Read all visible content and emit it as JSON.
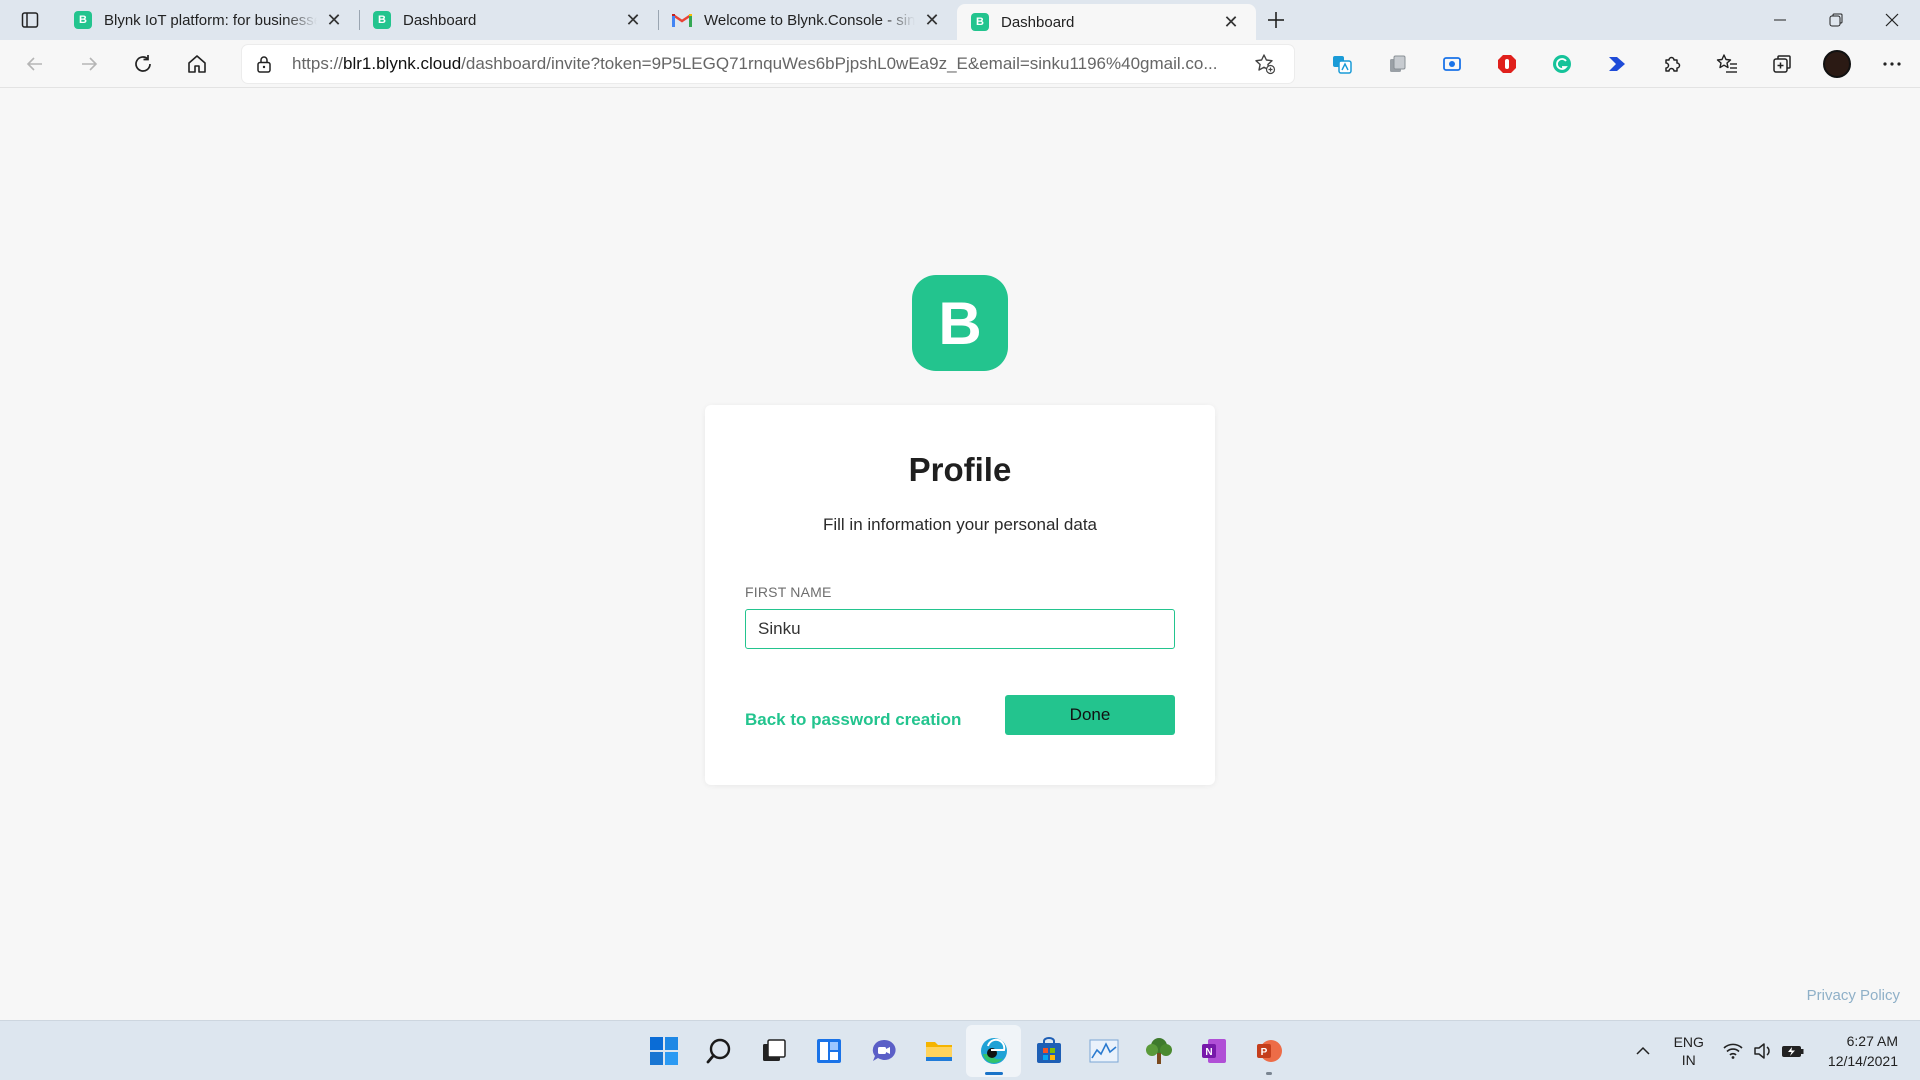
{
  "browser": {
    "tabs": [
      {
        "title": "Blynk IoT platform: for businesses",
        "favicon": "B",
        "icon": "blynk-favicon"
      },
      {
        "title": "Dashboard",
        "favicon": "B",
        "icon": "blynk-favicon"
      },
      {
        "title": "Welcome to Blynk.Console - sinku",
        "favicon": "",
        "icon": "gmail-favicon"
      },
      {
        "title": "Dashboard",
        "favicon": "B",
        "icon": "blynk-favicon",
        "active": true
      }
    ],
    "address": {
      "scheme": "https://",
      "host": "blr1.blynk.cloud",
      "path": "/dashboard/invite?token=9P5LEGQ71rnquWes6bPjpshL0wEa9z_E&email=sinku1196%40gmail.co..."
    }
  },
  "page": {
    "logo_letter": "B",
    "title": "Profile",
    "subtitle": "Fill in information your personal data",
    "first_name_label": "FIRST NAME",
    "first_name_value": "Sinku",
    "back_link": "Back to password creation",
    "done_button": "Done",
    "privacy_link": "Privacy Policy",
    "accent_color": "#23c48e"
  },
  "taskbar": {
    "language": "ENG",
    "region": "IN",
    "time": "6:27 AM",
    "date": "12/14/2021"
  }
}
